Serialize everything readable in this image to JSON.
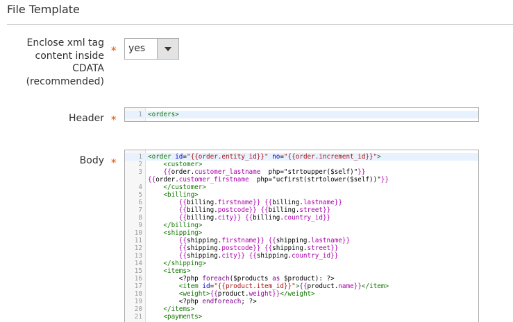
{
  "section": {
    "title": "File Template"
  },
  "fields": {
    "cdata": {
      "label_lines": [
        "Enclose xml tag",
        "content inside",
        "CDATA",
        "(recommended)"
      ],
      "required": "*",
      "value": "yes"
    },
    "header": {
      "label": "Header",
      "required": "*",
      "lines": [
        {
          "n": "1",
          "code": "<orders>"
        }
      ]
    },
    "body": {
      "label": "Body",
      "required": "*",
      "lines": [
        {
          "n": "1",
          "code": "<order id=\"{{order.entity_id}}\" no=\"{{order.increment_id}}\">"
        },
        {
          "n": "2",
          "code": "    <customer>"
        },
        {
          "n": "3",
          "code": "    {{order.customer_lastname  php=\"strtoupper($self)\"}}\n{{order.customer_firstname  php=\"ucfirst(strtolower($self))\"}}"
        },
        {
          "n": "4",
          "code": "    </customer>"
        },
        {
          "n": "5",
          "code": "    <billing>"
        },
        {
          "n": "6",
          "code": "        {{billing.firstname}} {{billing.lastname}}"
        },
        {
          "n": "7",
          "code": "        {{billing.postcode}} {{billing.street}}"
        },
        {
          "n": "8",
          "code": "        {{billing.city}} {{billing.country_id}}"
        },
        {
          "n": "9",
          "code": "    </billing>"
        },
        {
          "n": "10",
          "code": "    <shipping>"
        },
        {
          "n": "11",
          "code": "        {{shipping.firstname}} {{shipping.lastname}}"
        },
        {
          "n": "12",
          "code": "        {{shipping.postcode}} {{shipping.street}}"
        },
        {
          "n": "13",
          "code": "        {{shipping.city}} {{shipping.country_id}}"
        },
        {
          "n": "14",
          "code": "    </shipping>"
        },
        {
          "n": "15",
          "code": "    <items>"
        },
        {
          "n": "16",
          "code": "        <?php foreach($products as $product): ?>"
        },
        {
          "n": "17",
          "code": "        <item id=\"{{product.item_id}}\">{{product.name}}</item>"
        },
        {
          "n": "18",
          "code": "        <weight>{{product.weight}}</weight>"
        },
        {
          "n": "19",
          "code": "        <?php endforeach; ?>"
        },
        {
          "n": "20",
          "code": "    </items>"
        },
        {
          "n": "21",
          "code": "    <payments>"
        }
      ]
    }
  },
  "colors": {
    "required": "#eb5202",
    "tag": "#117700",
    "attribute": "#0000cc",
    "string": "#aa1111",
    "variable": "#aa00aa",
    "active_line": "#e8f2ff"
  }
}
